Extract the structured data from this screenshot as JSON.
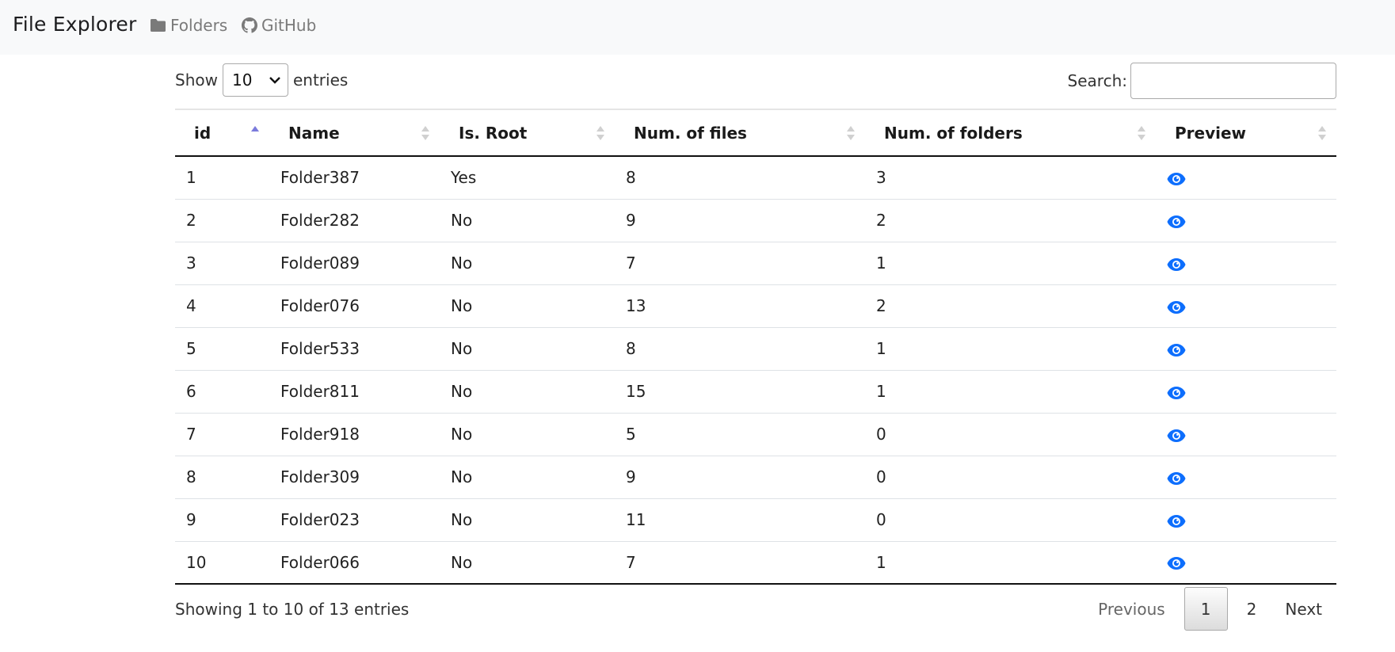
{
  "navbar": {
    "brand": "File Explorer",
    "links": [
      {
        "label": "Folders",
        "icon": "folder-icon"
      },
      {
        "label": "GitHub",
        "icon": "github-icon"
      }
    ]
  },
  "controls": {
    "show_label": "Show",
    "page_length": "10",
    "entries_label": "entries",
    "search_label": "Search:",
    "search_value": "",
    "search_placeholder": ""
  },
  "table": {
    "columns": [
      "id",
      "Name",
      "Is. Root",
      "Num. of files",
      "Num. of folders",
      "Preview"
    ],
    "sorted_column": "id",
    "sort_direction": "ascending",
    "rows": [
      {
        "id": "1",
        "name": "Folder387",
        "is_root": "Yes",
        "num_files": "8",
        "num_folders": "3",
        "preview": "eye-icon"
      },
      {
        "id": "2",
        "name": "Folder282",
        "is_root": "No",
        "num_files": "9",
        "num_folders": "2",
        "preview": "eye-icon"
      },
      {
        "id": "3",
        "name": "Folder089",
        "is_root": "No",
        "num_files": "7",
        "num_folders": "1",
        "preview": "eye-icon"
      },
      {
        "id": "4",
        "name": "Folder076",
        "is_root": "No",
        "num_files": "13",
        "num_folders": "2",
        "preview": "eye-icon"
      },
      {
        "id": "5",
        "name": "Folder533",
        "is_root": "No",
        "num_files": "8",
        "num_folders": "1",
        "preview": "eye-icon"
      },
      {
        "id": "6",
        "name": "Folder811",
        "is_root": "No",
        "num_files": "15",
        "num_folders": "1",
        "preview": "eye-icon"
      },
      {
        "id": "7",
        "name": "Folder918",
        "is_root": "No",
        "num_files": "5",
        "num_folders": "0",
        "preview": "eye-icon"
      },
      {
        "id": "8",
        "name": "Folder309",
        "is_root": "No",
        "num_files": "9",
        "num_folders": "0",
        "preview": "eye-icon"
      },
      {
        "id": "9",
        "name": "Folder023",
        "is_root": "No",
        "num_files": "11",
        "num_folders": "0",
        "preview": "eye-icon"
      },
      {
        "id": "10",
        "name": "Folder066",
        "is_root": "No",
        "num_files": "7",
        "num_folders": "1",
        "preview": "eye-icon"
      }
    ]
  },
  "footer": {
    "info": "Showing 1 to 10 of 13 entries",
    "pagination": {
      "previous": "Previous",
      "pages": [
        "1",
        "2"
      ],
      "current_page": "1",
      "next": "Next"
    }
  },
  "colors": {
    "navbar_bg": "#f8f9fa",
    "accent_eye": "#0d6efd",
    "sort_active": "#7b7bdc",
    "sort_inactive": "#d0d0d0"
  }
}
